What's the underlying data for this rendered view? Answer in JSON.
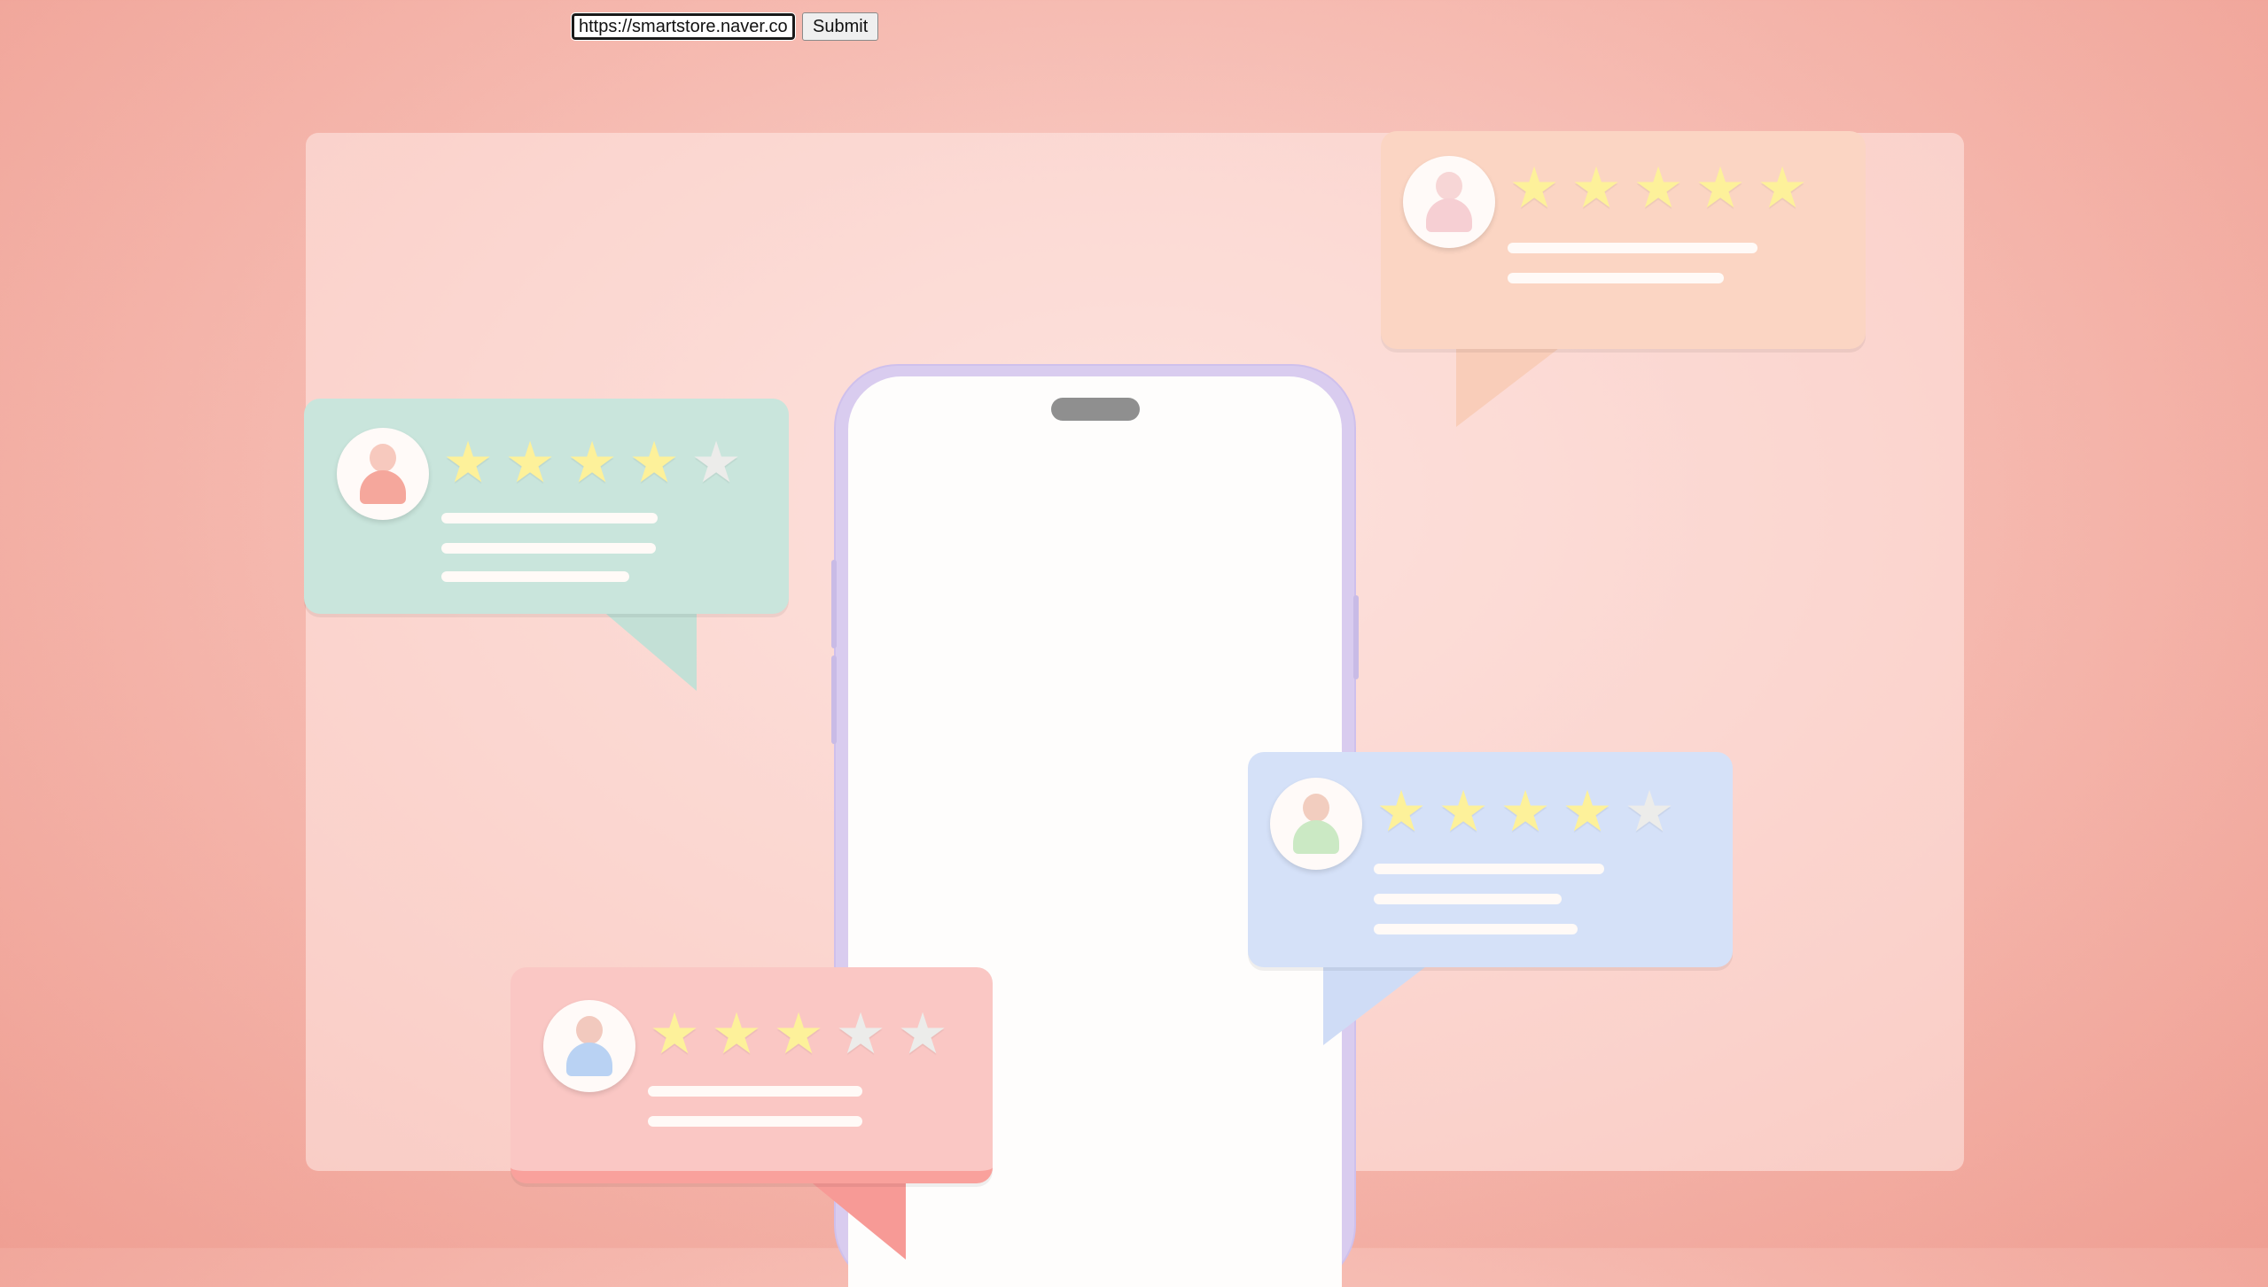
{
  "url_form": {
    "url_value": "https://smartstore.naver.com",
    "submit_label": "Submit"
  },
  "review_cards": [
    {
      "id": "orange",
      "rating": 5,
      "max": 5,
      "bubble_color": "#fbd5c3",
      "avatar_head": "#f7d6d6",
      "avatar_body": "#f6cfd3"
    },
    {
      "id": "green",
      "rating": 4,
      "max": 5,
      "bubble_color": "#c9e5dc",
      "avatar_head": "#f7c9be",
      "avatar_body": "#f5a79c"
    },
    {
      "id": "blue",
      "rating": 4,
      "max": 5,
      "bubble_color": "#d5e1f8",
      "avatar_head": "#f2cdbf",
      "avatar_body": "#cbe9c4"
    },
    {
      "id": "pink",
      "rating": 3,
      "max": 5,
      "bubble_color": "#fac7c4",
      "avatar_head": "#f2c9be",
      "avatar_body": "#b9d2f3"
    }
  ],
  "colors": {
    "star_filled": "#fdf19a",
    "star_empty": "#ececea",
    "phone_frame": "#d9ccef"
  },
  "icons": [
    "user-avatar-icon",
    "star-icon"
  ]
}
